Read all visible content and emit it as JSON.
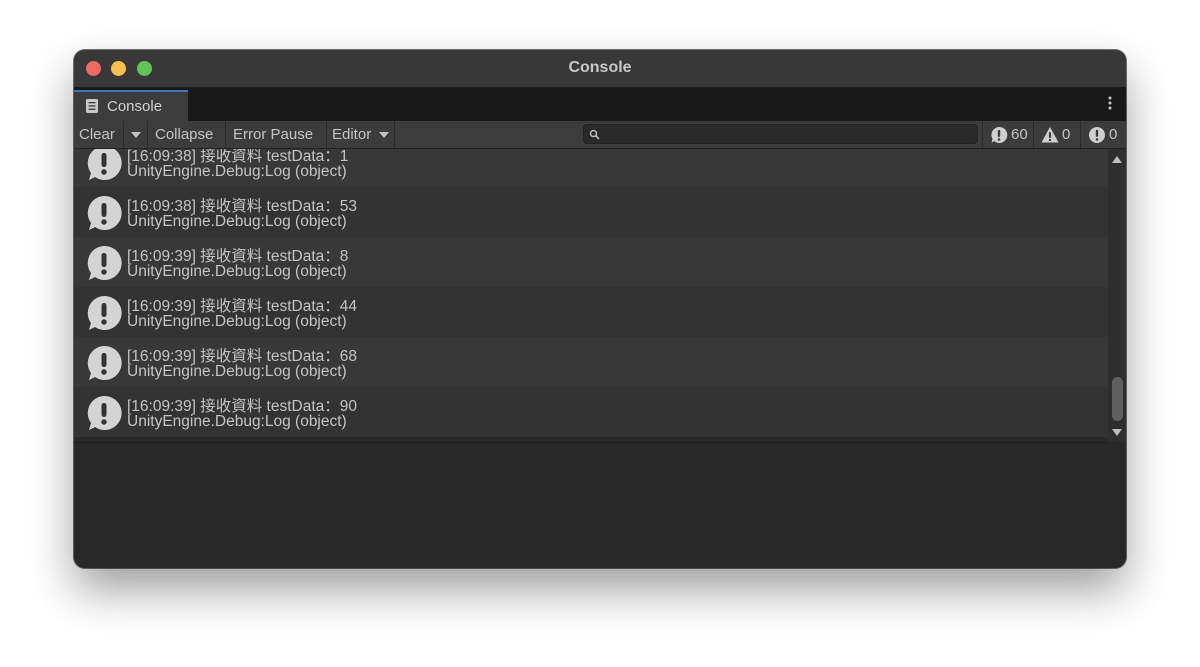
{
  "window": {
    "title": "Console"
  },
  "tabs": [
    {
      "label": "Console",
      "icon": "console-list-icon"
    }
  ],
  "toolbar": {
    "clear_label": "Clear",
    "collapse_label": "Collapse",
    "error_pause_label": "Error Pause",
    "editor_label": "Editor",
    "search": {
      "value": "",
      "placeholder": ""
    },
    "counters": {
      "info": "60",
      "warning": "0",
      "error": "0"
    }
  },
  "logs": [
    {
      "message": "[16:09:38] 接收資料 testData：1",
      "stack": "UnityEngine.Debug:Log (object)"
    },
    {
      "message": "[16:09:38] 接收資料 testData：53",
      "stack": "UnityEngine.Debug:Log (object)"
    },
    {
      "message": "[16:09:39] 接收資料 testData：8",
      "stack": "UnityEngine.Debug:Log (object)"
    },
    {
      "message": "[16:09:39] 接收資料 testData：44",
      "stack": "UnityEngine.Debug:Log (object)"
    },
    {
      "message": "[16:09:39] 接收資料 testData：68",
      "stack": "UnityEngine.Debug:Log (object)"
    },
    {
      "message": "[16:09:39] 接收資料 testData：90",
      "stack": "UnityEngine.Debug:Log (object)"
    }
  ],
  "colors": {
    "window_bg": "#282828",
    "toolbar_bg": "#3c3c3c",
    "tab_accent": "#3a79bb",
    "text": "#c4c4c4",
    "row_odd": "#383838",
    "row_even": "#333333",
    "traffic_close": "#ed6a5e",
    "traffic_minimize": "#f4bf4f",
    "traffic_maximize": "#61c554"
  }
}
